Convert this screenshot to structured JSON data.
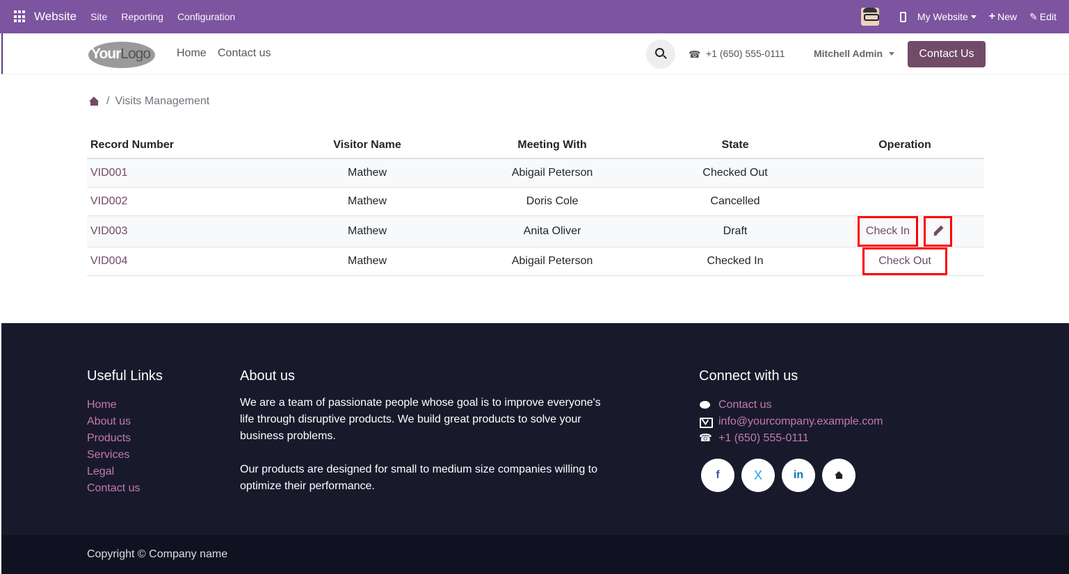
{
  "topbar": {
    "brand": "Website",
    "menus": [
      "Site",
      "Reporting",
      "Configuration"
    ],
    "website_selector": "My Website",
    "new_label": "New",
    "edit_label": "Edit"
  },
  "header": {
    "logo_your": "Your",
    "logo_logo": "Logo",
    "nav": [
      "Home",
      "Contact us"
    ],
    "phone": "+1 (650) 555-0111",
    "user": "Mitchell Admin",
    "contact_button": "Contact Us"
  },
  "breadcrumb": {
    "separator": "/",
    "current": "Visits Management"
  },
  "table": {
    "headers": [
      "Record Number",
      "Visitor Name",
      "Meeting With",
      "State",
      "Operation"
    ],
    "rows": [
      {
        "record": "VID001",
        "visitor": "Mathew",
        "meeting": "Abigail Peterson",
        "state": "Checked Out"
      },
      {
        "record": "VID002",
        "visitor": "Mathew",
        "meeting": "Doris Cole",
        "state": "Cancelled"
      },
      {
        "record": "VID003",
        "visitor": "Mathew",
        "meeting": "Anita Oliver",
        "state": "Draft",
        "op": "Check In"
      },
      {
        "record": "VID004",
        "visitor": "Mathew",
        "meeting": "Abigail Peterson",
        "state": "Checked In",
        "op": "Check Out"
      }
    ]
  },
  "footer": {
    "useful_links_title": "Useful Links",
    "useful_links": [
      "Home",
      "About us",
      "Products",
      "Services",
      "Legal",
      "Contact us"
    ],
    "about_title": "About us",
    "about_p1": "We are a team of passionate people whose goal is to improve everyone's life through disruptive products. We build great products to solve your business problems.",
    "about_p2": "Our products are designed for small to medium size companies willing to optimize their performance.",
    "connect_title": "Connect with us",
    "connect_contact": "Contact us",
    "connect_email": "info@yourcompany.example.com",
    "connect_phone": "+1 (650) 555-0111",
    "socials": {
      "facebook": "f",
      "x": "X",
      "linkedin": "in"
    },
    "copyright": "Copyright © Company name"
  }
}
